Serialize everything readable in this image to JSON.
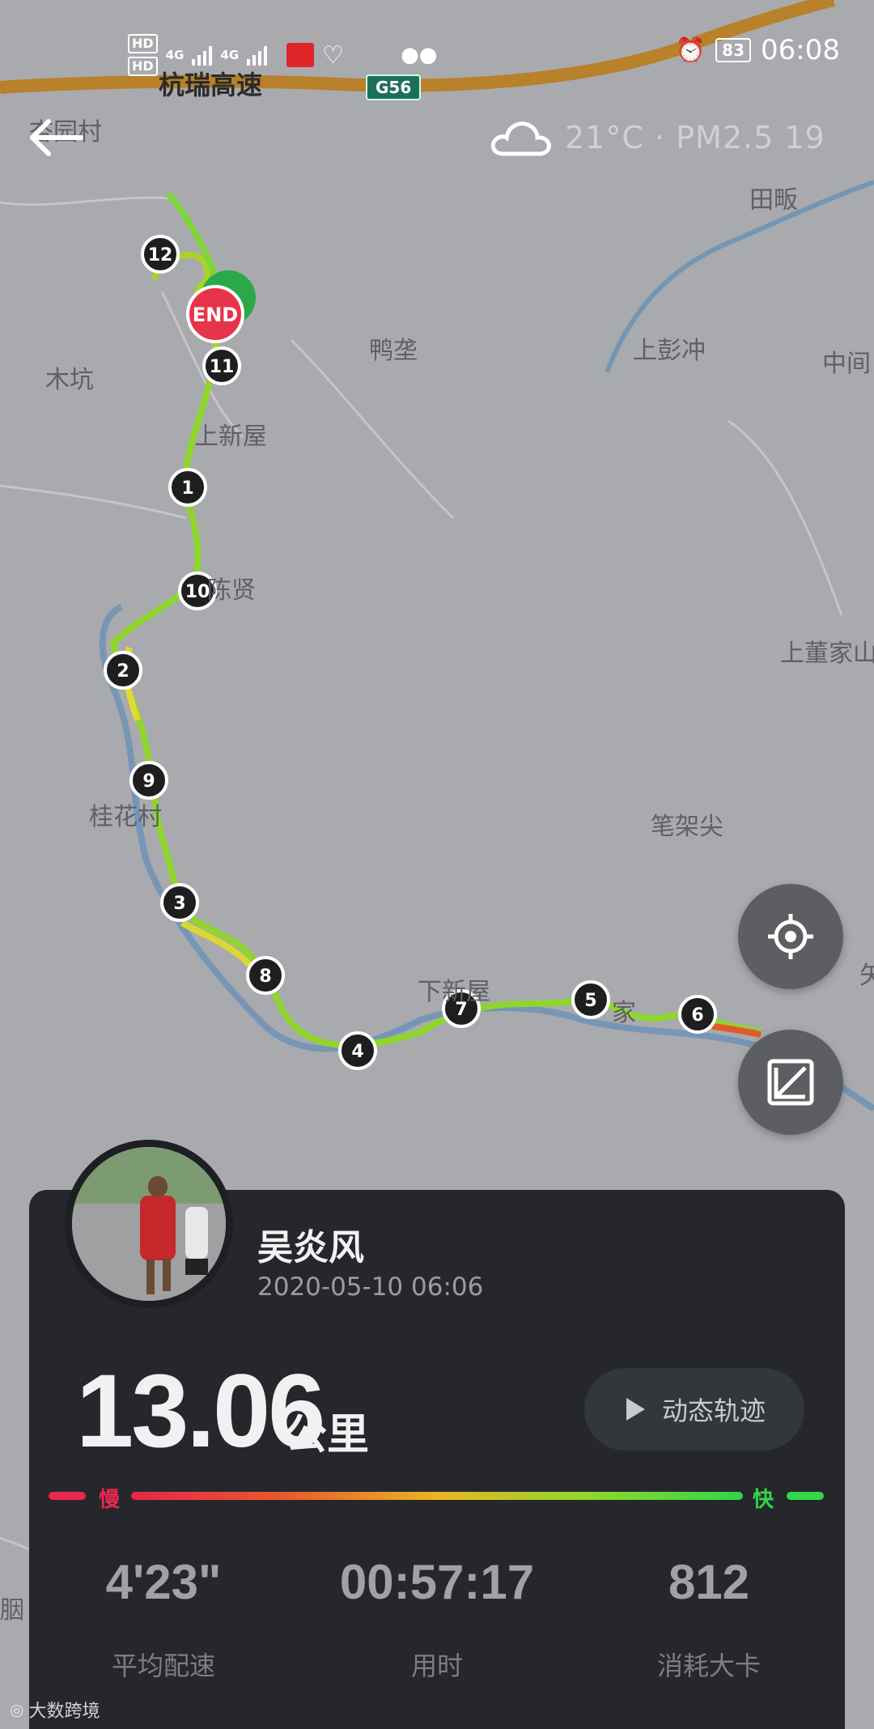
{
  "status_bar": {
    "hd1": "HD",
    "hd2": "HD",
    "net1": "4G",
    "net2": "4G",
    "battery": "83",
    "time": "06:08"
  },
  "weather": {
    "text": "21°C · PM2.5 19",
    "icon": "cloud-icon"
  },
  "map": {
    "road_name": "杭瑞高速",
    "road_shield": "G56",
    "labels": {
      "xingyuan": "杏园村",
      "tianfan": "田畈",
      "yazhu": "鸭垄",
      "shangpengchong": "上彭冲",
      "zhongjian": "中间",
      "mukeng": "木坑",
      "shangxinwu": "上新屋",
      "chenxian": "陈贤",
      "shangdongjia": "上董家山",
      "guihua": "桂花村",
      "bijiajian": "笔架尖",
      "xiaxinwu": "下新屋",
      "jia": "家",
      "side_left": "胭",
      "side_right": "矢"
    },
    "end_marker": "END",
    "km_markers": [
      "1",
      "2",
      "3",
      "4",
      "5",
      "6",
      "7",
      "8",
      "9",
      "10",
      "11",
      "12"
    ]
  },
  "buttons": {
    "locate_icon": "locate-icon",
    "fit_icon": "fit-route-icon",
    "replay_label": "动态轨迹"
  },
  "user": {
    "name": "吴炎风",
    "datetime": "2020-05-10 06:06"
  },
  "summary": {
    "distance": "13.06",
    "distance_unit": "公里",
    "speed_slow": "慢",
    "speed_fast": "快",
    "pace": "4'23\"",
    "pace_label": "平均配速",
    "duration": "00:57:17",
    "duration_label": "用时",
    "calories": "812",
    "calories_label": "消耗大卡"
  },
  "watermark": "大数跨境"
}
